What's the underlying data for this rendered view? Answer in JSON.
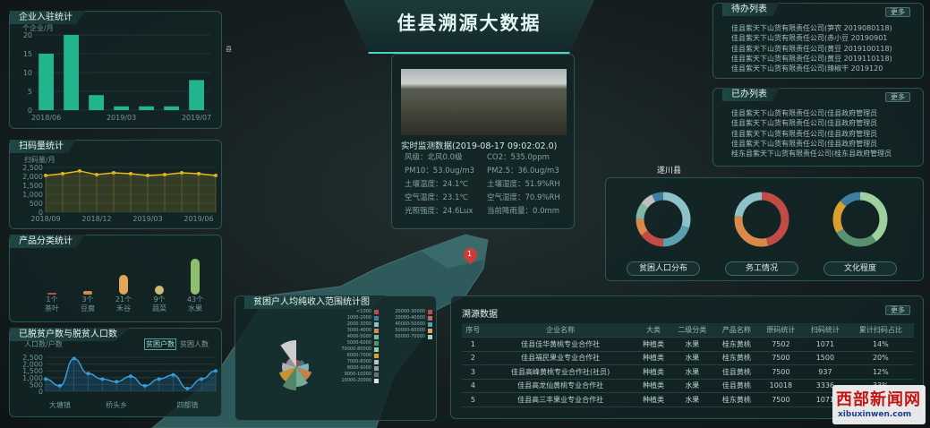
{
  "header": {
    "title": "佳县溯源大数据"
  },
  "map": {
    "labels": [
      "遂川县",
      "县"
    ],
    "marker": "1"
  },
  "enterprise": {
    "title": "企业入驻统计",
    "unit": "个企业/月",
    "y_ticks": [
      "20",
      "15",
      "10",
      "5",
      "0"
    ],
    "x_ticks": [
      "2018/06",
      "2019/03",
      "2019/07"
    ]
  },
  "scan": {
    "title": "扫码量统计",
    "unit": "扫码量/月",
    "y_ticks": [
      "2,500",
      "2,000",
      "1,500",
      "1,000",
      "500",
      "0"
    ],
    "x_ticks": [
      "2018/09",
      "2018/12",
      "2019/03",
      "2019/06"
    ]
  },
  "products": {
    "title": "产品分类统计",
    "items": [
      {
        "count": "1个",
        "name": "茶叶",
        "color": "#c04c45"
      },
      {
        "count": "3个",
        "name": "豆腐",
        "color": "#d98a4a"
      },
      {
        "count": "21个",
        "name": "禾谷",
        "color": "#e3a55a"
      },
      {
        "count": "9个",
        "name": "蔬菜",
        "color": "#c9bd73"
      },
      {
        "count": "43个",
        "name": "水果",
        "color": "#8fbf6a"
      }
    ]
  },
  "poverty": {
    "title": "已脱贫户数与脱贫人口数",
    "unit": "人口数/户数",
    "legend_a": "贫困户数",
    "legend_b": "贫困人数",
    "y_ticks": [
      "2,500",
      "2,000",
      "1,500",
      "1,000",
      "500",
      "0"
    ],
    "x_ticks": [
      "大塘镇",
      "桥头乡",
      "四都镇"
    ]
  },
  "monitor": {
    "heading": "实时监测数据(2019-08-17 09:02:02.0)",
    "rows": [
      [
        "风级：北风0.0级",
        "CO2：535.0ppm"
      ],
      [
        "PM10：53.0ug/m3",
        "PM2.5：36.0ug/m3"
      ],
      [
        "土壤温度：24.1℃",
        "土壤湿度：51.9%RH"
      ],
      [
        "空气温度：23.1℃",
        "空气湿度：70.9%RH"
      ],
      [
        "光照强度：24.6Lux",
        "当前降雨量：0.0mm"
      ]
    ]
  },
  "income": {
    "title": "贫困户人均纯收入范围统计图",
    "legend": [
      {
        "label": "<1000",
        "color": "#c04c45"
      },
      {
        "label": "20000-30000",
        "color": "#c04c45"
      },
      {
        "label": "1000-2000",
        "color": "#3d7fa0"
      },
      {
        "label": "20000-40000",
        "color": "#c06a5a"
      },
      {
        "label": "2000-3000",
        "color": "#8fc2c8"
      },
      {
        "label": "40000-50000",
        "color": "#5aa0b0"
      },
      {
        "label": "3000-4000",
        "color": "#d98a4a"
      },
      {
        "label": "50000-60000",
        "color": "#e3a55a"
      },
      {
        "label": "4000-5000",
        "color": "#7fb8a0"
      },
      {
        "label": "60000-70000",
        "color": "#a8d0b8"
      },
      {
        "label": "5000-6000",
        "color": "#5a8f70"
      },
      {
        "label": "70000-80000",
        "color": "#9fd0a0"
      },
      {
        "label": "6000-7000",
        "color": "#d9a030"
      },
      {
        "label": "7000-8000",
        "color": "#c0c0c0"
      },
      {
        "label": "8000-9000",
        "color": "#a0a0a0"
      },
      {
        "label": "9000-10000",
        "color": "#707070"
      },
      {
        "label": "10000-20000",
        "color": "#e0e0e0"
      }
    ]
  },
  "todo": {
    "title": "待办列表",
    "more": "更多",
    "items": [
      "佳县紫天下山货有限责任公司(笋农 2019080118)",
      "佳县紫天下山货有限责任公司(赤小豆 20190901",
      "佳县紫天下山货有限责任公司(黄豆 2019100118)",
      "佳县紫天下山货有限责任公司(黄豆 2019110118)",
      "佳县紫天下山货有限责任公司(辣椒干 2019120"
    ]
  },
  "done": {
    "title": "已办列表",
    "more": "更多",
    "items": [
      "佳县紫天下山货有限责任公司(佳县政府管理员",
      "佳县紫天下山货有限责任公司(佳县政府管理员",
      "佳县紫天下山货有限责任公司(佳县政府管理员",
      "佳县紫天下山货有限责任公司(佳县政府管理员",
      "桂东县紫天下山货有限责任公司(桂东县政府管理员"
    ]
  },
  "donuts": {
    "region": "遂川县",
    "items": [
      {
        "label": "贫困人口分布",
        "colors": [
          "#8fc2c8",
          "#5aa0b0",
          "#c04c45",
          "#d98a4a",
          "#7fb8a0",
          "#c0c0c0",
          "#3d7fa0"
        ]
      },
      {
        "label": "务工情况",
        "colors": [
          "#c04c45",
          "#d98a4a",
          "#8fc2c8"
        ]
      },
      {
        "label": "文化程度",
        "colors": [
          "#9fd0a0",
          "#5a8f70",
          "#d9a030",
          "#3d7fa0"
        ]
      }
    ]
  },
  "traceability": {
    "title": "溯源数据",
    "more": "更多",
    "columns": [
      "序号",
      "企业名称",
      "大类",
      "二级分类",
      "产品名称",
      "原码统计",
      "扫码统计",
      "累计扫码占比"
    ],
    "rows": [
      [
        "1",
        "佳县佳华黄桃专业合作社",
        "种植类",
        "水果",
        "桂东黄桃",
        "7502",
        "1071",
        "14%"
      ],
      [
        "2",
        "佳县福民果业专业合作社",
        "种植类",
        "水果",
        "桂东黄桃",
        "7500",
        "1500",
        "20%"
      ],
      [
        "3",
        "佳县高峰黄桃专业合作社(社员)",
        "种植类",
        "水果",
        "佳县黄桃",
        "7500",
        "937",
        "12%"
      ],
      [
        "4",
        "佳县高龙仙黄桃专业合作社",
        "种植类",
        "水果",
        "佳县黄桃",
        "10018",
        "3336",
        "33%"
      ],
      [
        "5",
        "佳县高三丰果业专业合作社",
        "种植类",
        "水果",
        "桂东黄桃",
        "7500",
        "1071",
        "14%"
      ]
    ]
  },
  "watermark": {
    "cn": "西部新闻网",
    "url": "xibuxinwen.com"
  },
  "chart_data": [
    {
      "type": "bar",
      "title": "企业入驻统计",
      "ylabel": "个企业/月",
      "categories": [
        "2018/06",
        "",
        "",
        "2019/03",
        "",
        "",
        "2019/07"
      ],
      "values": [
        15,
        20,
        4,
        1,
        1,
        1,
        8
      ],
      "ylim": [
        0,
        20
      ]
    },
    {
      "type": "line",
      "title": "扫码量统计",
      "ylabel": "扫码量/月",
      "x": [
        "2018/09",
        "",
        "",
        "2018/12",
        "",
        "",
        "2019/03",
        "",
        "",
        "2019/06",
        ""
      ],
      "values": [
        2050,
        2150,
        2300,
        2100,
        2200,
        2150,
        2050,
        2100,
        2200,
        2150,
        2050
      ],
      "ylim": [
        0,
        2500
      ]
    },
    {
      "type": "line",
      "title": "已脱贫户数与脱贫人口数",
      "ylabel": "人口数/户数",
      "series": [
        {
          "name": "贫困户数",
          "values": [
            900,
            400,
            2400,
            1300,
            900,
            700,
            1100,
            400,
            900,
            1200,
            200,
            900,
            1500
          ]
        }
      ],
      "ylim": [
        0,
        2500
      ]
    }
  ]
}
